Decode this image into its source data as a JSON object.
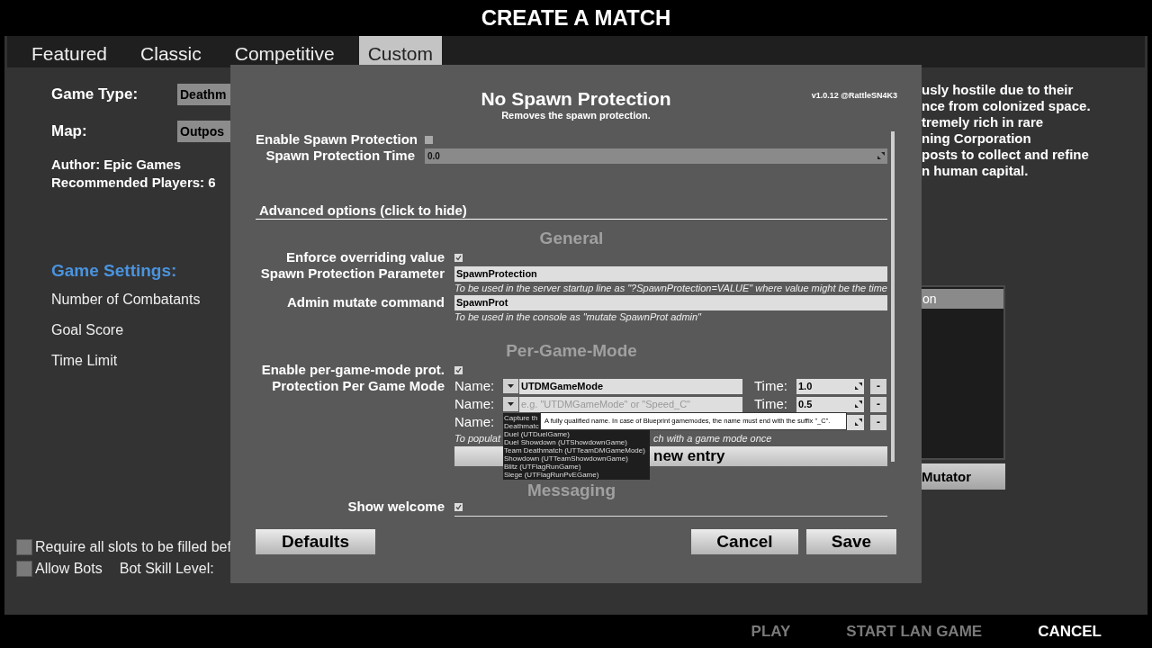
{
  "window": {
    "title": "CREATE A MATCH"
  },
  "tabs": [
    {
      "label": "Featured",
      "selected": false
    },
    {
      "label": "Classic",
      "selected": false
    },
    {
      "label": "Competitive",
      "selected": false
    },
    {
      "label": "Custom",
      "selected": true
    }
  ],
  "game_type": {
    "label": "Game Type:",
    "value": "Deathm"
  },
  "map": {
    "label": "Map:",
    "value": "Outpos"
  },
  "map_info": [
    "Author: Epic Games",
    "Recommended Players: 6"
  ],
  "settings": {
    "heading": "Game Settings:",
    "items": [
      "Number of Combatants",
      "Goal Score",
      "Time Limit"
    ]
  },
  "description_lines": [
    "usly hostile due to their",
    "nce from colonized space.",
    "tremely rich in rare",
    "ning Corporation",
    "posts to collect and refine",
    "n human capital."
  ],
  "mutator_list": {
    "items": [
      {
        "label": "on",
        "selected": true
      }
    ],
    "button": "Mutator"
  },
  "options": [
    {
      "label": "Require all slots to be filled bef",
      "checked": false
    },
    {
      "label": "Allow Bots",
      "checked": false
    }
  ],
  "bot_skill_label": "Bot Skill Level:",
  "footer_actions": [
    {
      "label": "PLAY",
      "disabled": true
    },
    {
      "label": "START LAN GAME",
      "disabled": true
    },
    {
      "label": "CANCEL",
      "disabled": false
    }
  ],
  "dialog": {
    "title": "No Spawn Protection",
    "subtitle": "Removes the spawn protection.",
    "version": "v1.0.12 @RattleSN4K3",
    "basic": [
      {
        "kind": "checkbox",
        "label": "Enable Spawn Protection",
        "checked": false
      },
      {
        "kind": "number",
        "label": "Spawn Protection Time",
        "value": "0.0"
      }
    ],
    "advanced_toggle": "Advanced options (click to hide)",
    "sections": [
      {
        "heading": "General",
        "rows": [
          {
            "kind": "checkbox",
            "label": "Enforce overriding value",
            "checked": true
          },
          {
            "kind": "text",
            "label": "Spawn Protection Parameter",
            "value": "SpawnProtection",
            "hint": "To be used in the server startup line as \"?SpawnProtection=VALUE\" where value might be the time"
          },
          {
            "kind": "text",
            "label": "Admin mutate command",
            "value": "SpawnProt",
            "hint": "To be used in the console as \"mutate SpawnProt admin\""
          }
        ]
      },
      {
        "heading": "Per-Game-Mode",
        "rows": [
          {
            "kind": "checkbox",
            "label": "Enable per-game-mode prot.",
            "checked": true
          },
          {
            "kind": "modes",
            "label": "Protection Per Game Mode",
            "entries": [
              {
                "name_label": "Name:",
                "value": "UTDMGameMode",
                "time_label": "Time:",
                "time": "1.0",
                "remove": "-"
              },
              {
                "name_label": "Name:",
                "placeholder": "e.g. \"UTDMGameMode\" or \"Speed_C\"",
                "time_label": "Time:",
                "time": "0.5",
                "remove": "-"
              },
              {
                "name_label": "Name:",
                "remove": "-"
              }
            ],
            "hint_parts": [
              "To populat",
              "ch with a game mode once"
            ],
            "add_button": "new entry"
          }
        ]
      },
      {
        "heading": "Messaging",
        "rows": [
          {
            "kind": "checkbox",
            "label": "Show welcome",
            "checked": true
          },
          {
            "kind": "cut_field"
          }
        ]
      }
    ],
    "mode_dropdown": [
      "Capture th",
      "Deathmatc",
      "Duel (UTDuelGame)",
      "Duel Showdown (UTShowdownGame)",
      "Team Deathmatch (UTTeamDMGameMode)",
      "Showdown (UTTeamShowdownGame)",
      "Blitz (UTFlagRunGame)",
      "Siege (UTFlagRunPvEGame)"
    ],
    "tooltip": "A fully qualified name. In case of Blueprint gamemodes, the name must end with the suffix \"_C\".",
    "buttons": {
      "defaults": "Defaults",
      "cancel": "Cancel",
      "save": "Save"
    }
  }
}
